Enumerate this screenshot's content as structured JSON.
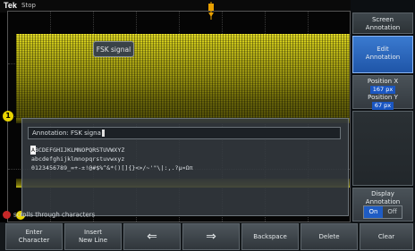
{
  "header": {
    "brand": "Tek",
    "run_state": "Stop"
  },
  "waveform": {
    "label": "FSK signal",
    "color": "#e8e01e",
    "channel": "1"
  },
  "annotation_dialog": {
    "field_prefix": "Annotation:",
    "field_value": "FSK signa",
    "charset_rows": [
      "ABCDEFGHIJKLMNOPQRSTUVWXYZ",
      "abcdefghijklmnopqrstuvwxyz",
      "0123456789_=+-±!@#$%^&*()[]{}<>/~'\"\\|:,.?µ¤Ωπ"
    ],
    "selected_char": "A",
    "hint": "scrolls through characters"
  },
  "side_menu": {
    "title_line1": "Screen",
    "title_line2": "Annotation",
    "edit_line1": "Edit",
    "edit_line2": "Annotation",
    "pos_x_label": "Position X",
    "pos_x_value": "167 px",
    "pos_y_label": "Position Y",
    "pos_y_value": "67 px",
    "display_line1": "Display",
    "display_line2": "Annotation",
    "on": "On",
    "off": "Off"
  },
  "bottom_menu": {
    "enter_line1": "Enter",
    "enter_line2": "Character",
    "insert_line1": "Insert",
    "insert_line2": "New Line",
    "left_arrow": "⇐",
    "right_arrow": "⇒",
    "backspace": "Backspace",
    "delete": "Delete",
    "clear": "Clear"
  },
  "colors": {
    "accent": "#1f5cc4",
    "trigger": "#e8a000",
    "channel1": "#e8d400",
    "knob": "#c62828"
  }
}
